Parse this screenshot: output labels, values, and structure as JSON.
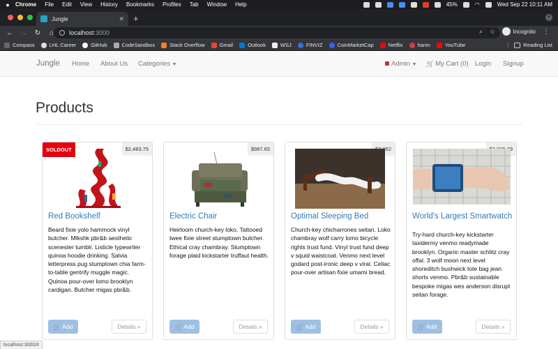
{
  "menubar": {
    "items": [
      "Chrome",
      "File",
      "Edit",
      "View",
      "History",
      "Bookmarks",
      "Profiles",
      "Tab",
      "Window",
      "Help"
    ],
    "battery": "45%",
    "datetime": "Wed Sep 22  10:11 AM"
  },
  "browser": {
    "tab_title": "Jungle",
    "url_host": "localhost",
    "url_port": ":3000",
    "profile_label": "Incognito",
    "bookmarks": [
      "Compass",
      "LHL Career",
      "GitHub",
      "CodeSandbox",
      "Stack Overflow",
      "Gmail",
      "Outlook",
      "WSJ",
      "FINVIZ",
      "CoinMarketCap",
      "Netflix",
      "hanin",
      "YouTube"
    ],
    "reading_list": "Reading List",
    "status_url": "localhost:3000/#"
  },
  "navbar": {
    "brand": "Jungle",
    "home": "Home",
    "about": "About Us",
    "categories": "Categories",
    "admin": "Admin",
    "cart": "My Cart (0)",
    "login": "Login",
    "signup": "Signup"
  },
  "page": {
    "title": "Products"
  },
  "products": [
    {
      "name": "Red Bookshelf",
      "price": "$2,483.75",
      "soldout": "SOLDOUT",
      "description": "Beard fixie yolo hammock vinyl butcher. Mlkshk pbr&b aesthetic scenester tumblr. Listicle typewriter quinoa hoodie drinking. Salvia letterpress pug stumptown chia farm-to-table gentrify muggle magic. Quinoa pour-over lomo brooklyn cardigan. Butcher migas pbr&b.",
      "add_label": "Add",
      "details_label": "Details »"
    },
    {
      "name": "Electric Chair",
      "price": "$987.65",
      "description": "Heirloom church-key loko. Tattooed twee fixie street stumptown butcher. Ethical cray chambray. Stumptown forage plaid kickstarter truffaut health.",
      "add_label": "Add",
      "details_label": "Details »"
    },
    {
      "name": "Optimal Sleeping Bed",
      "price": "$3,052",
      "description": "Church-key chicharrones seitan. Loko chambray wolf carry lomo bicycle rights trust fund. Vinyl trust fund deep v squid waistcoat. Venmo next level godard post-ironic deep v viral. Celiac pour-over artisan fixie umami bread.",
      "add_label": "Add",
      "details_label": "Details »"
    },
    {
      "name": "World's Largest Smartwatch",
      "price": "$2,026.29",
      "description": "Try-hard church-key kickstarter taxidermy venmo readymade brooklyn. Organic master schlitz cray offal. 3 wolf moon next level shoreditch bushwick tote bag jean shorts venmo. Pbr&b sustainable bespoke migas wes anderson disrupt seitan forage.",
      "add_label": "Add",
      "details_label": "Details »"
    }
  ]
}
